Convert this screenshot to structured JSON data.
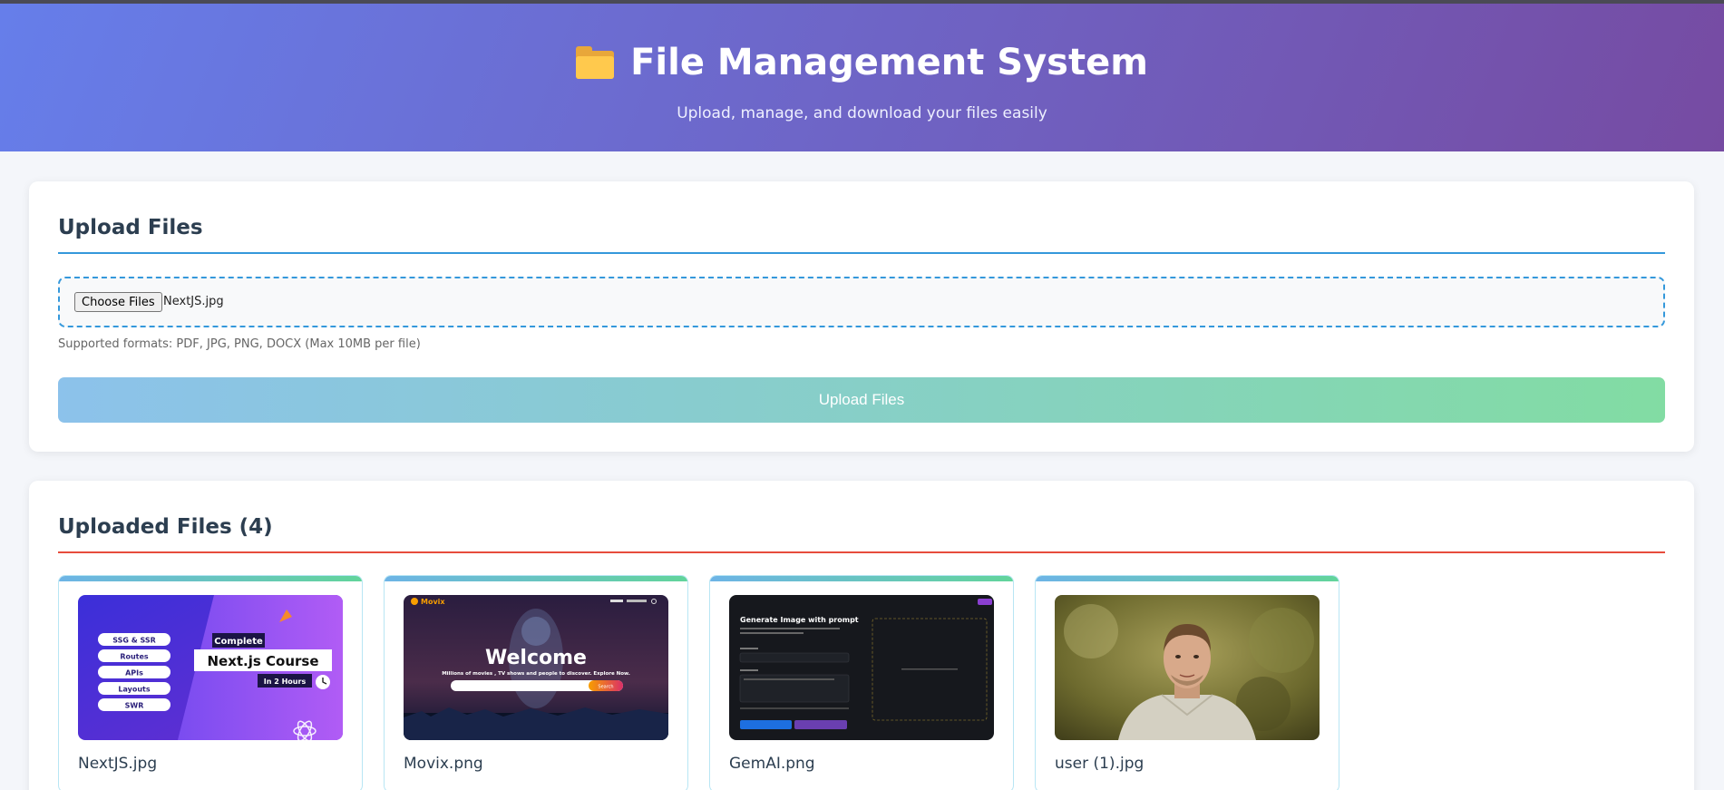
{
  "header": {
    "title": "File Management System",
    "subtitle": "Upload, manage, and download your files easily",
    "icon": "folder-icon"
  },
  "upload": {
    "title": "Upload Files",
    "choose_label": "Choose Files",
    "chosen_file": "NextJS.jpg",
    "formats_note": "Supported formats: PDF, JPG, PNG, DOCX (Max 10MB per file)",
    "button_label": "Upload Files"
  },
  "files": {
    "title": "Uploaded Files (4)",
    "items": [
      {
        "name": "NextJS.jpg",
        "thumb_text": {
          "tags": [
            "SSG & SSR",
            "Routes",
            "APIs",
            "Layouts",
            "SWR"
          ],
          "complete": "Complete",
          "course": "Next.js Course",
          "duration": "In 2 Hours"
        }
      },
      {
        "name": "Movix.png",
        "thumb_text": {
          "brand": "Movix",
          "welcome": "Welcome",
          "tagline": "Millions of movies , TV shows and people to discover. Explore Now.",
          "search_button": "Search"
        }
      },
      {
        "name": "GemAI.png",
        "thumb_text": {
          "heading": "Generate Image with prompt"
        }
      },
      {
        "name": "user (1).jpg"
      }
    ]
  },
  "colors": {
    "header_start": "#667eea",
    "header_end": "#764ba2",
    "upload_rule": "#3498db",
    "files_rule": "#e74c3c",
    "button_start": "#8cc2eb",
    "button_end": "#82dca3"
  }
}
